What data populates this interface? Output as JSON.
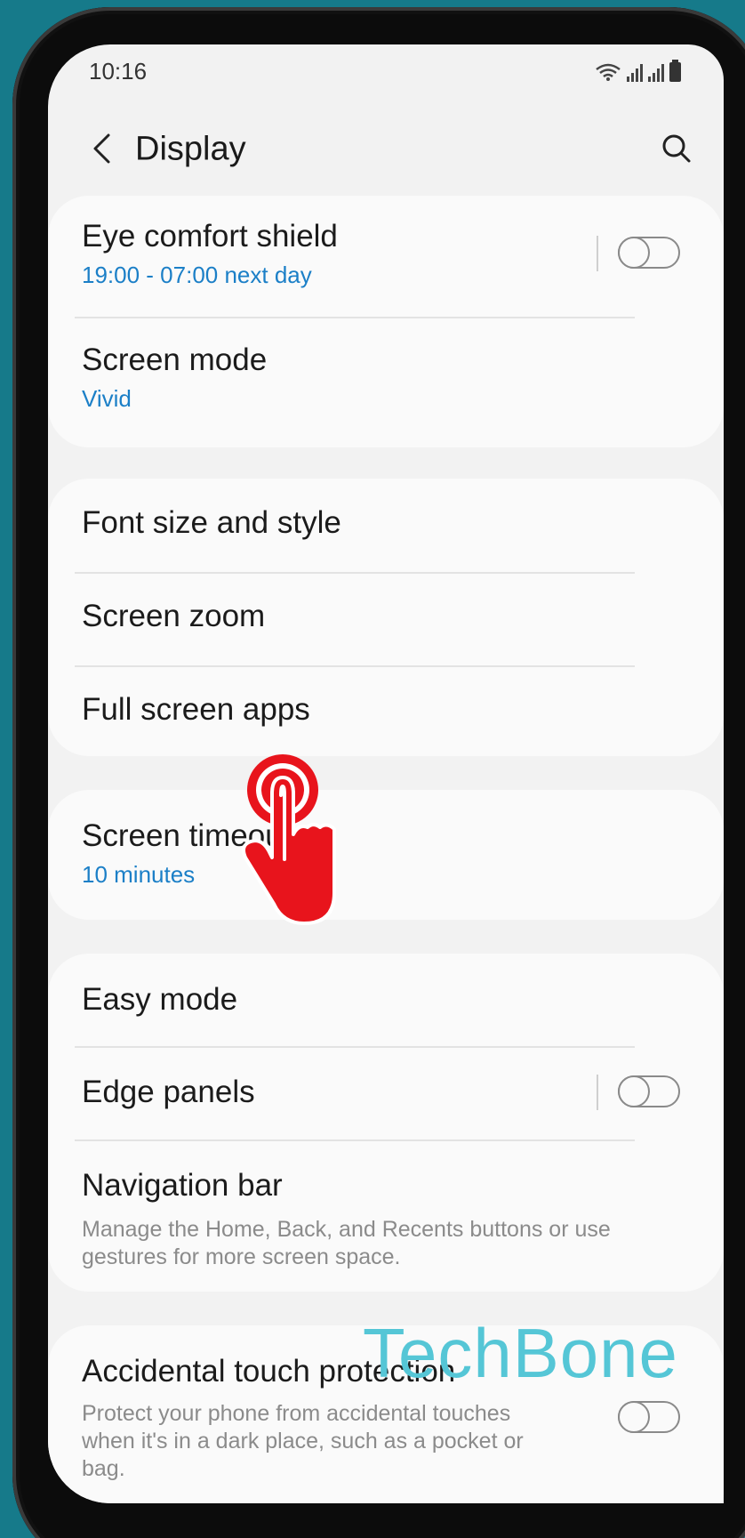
{
  "status_bar": {
    "time": "10:16"
  },
  "header": {
    "title": "Display"
  },
  "settings": {
    "eye_comfort": {
      "title": "Eye comfort shield",
      "subtitle": "19:00 - 07:00 next day",
      "enabled": false
    },
    "screen_mode": {
      "title": "Screen mode",
      "subtitle": "Vivid"
    },
    "font_size": {
      "title": "Font size and style"
    },
    "screen_zoom": {
      "title": "Screen zoom"
    },
    "full_screen_apps": {
      "title": "Full screen apps"
    },
    "screen_timeout": {
      "title": "Screen timeout",
      "subtitle": "10 minutes"
    },
    "easy_mode": {
      "title": "Easy mode"
    },
    "edge_panels": {
      "title": "Edge panels",
      "enabled": false
    },
    "navigation_bar": {
      "title": "Navigation bar",
      "description": "Manage the Home, Back, and Recents buttons or use gestures for more screen space."
    },
    "accidental_touch": {
      "title": "Accidental touch protection",
      "description": "Protect your phone from accidental touches when it's in a dark place, such as a pocket or bag.",
      "enabled": false
    }
  },
  "overlay": {
    "watermark": "TechBone",
    "tap_indicator_icon": "hand-tap-icon"
  },
  "colors": {
    "background": "#167a8a",
    "accent": "#1b7fc7",
    "tap_red": "#e8141c",
    "watermark": "#55c6d6"
  }
}
